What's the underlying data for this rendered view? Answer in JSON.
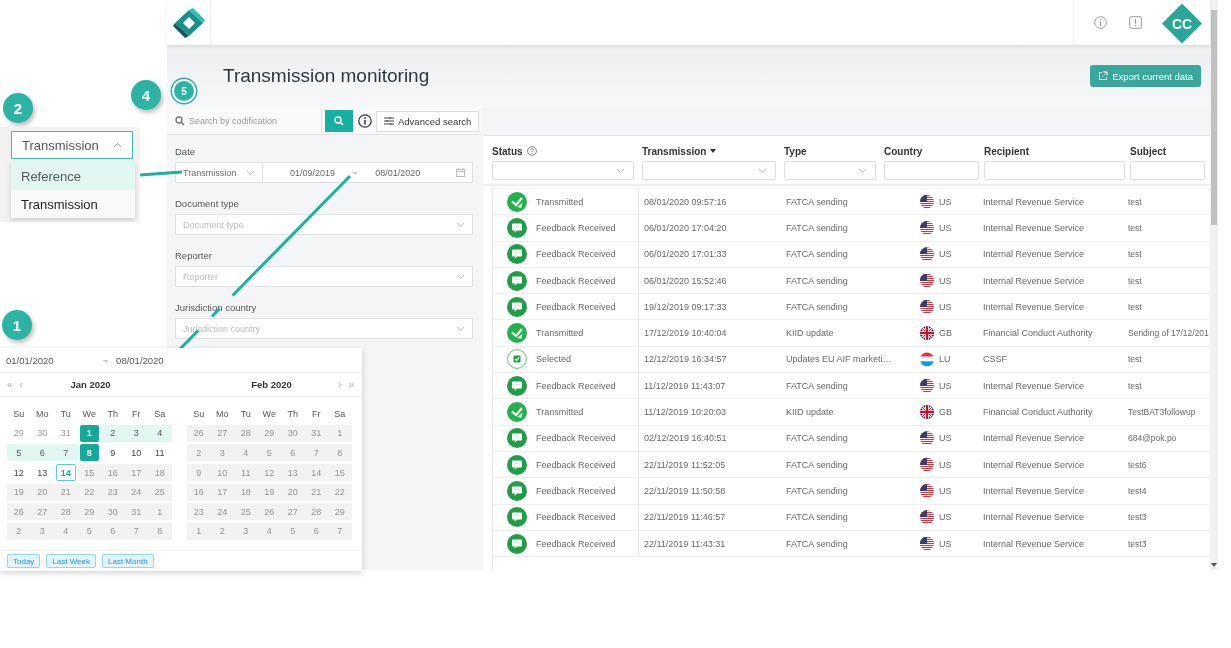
{
  "app": {
    "header": {
      "avatar": "CC"
    },
    "title": "Transmission monitoring",
    "export_button": "Export current data",
    "search": {
      "placeholder": "Search by codification",
      "advanced_button": "Advanced search"
    },
    "filters": [
      {
        "label": "Date",
        "kind": "date",
        "type_value": "Transmission",
        "from": "01/09/2019",
        "separator": "~",
        "to": "08/01/2020"
      },
      {
        "label": "Document type",
        "kind": "select",
        "placeholder": "Document type"
      },
      {
        "label": "Reporter",
        "kind": "select",
        "placeholder": "Reporter"
      },
      {
        "label": "Jurisdiction country",
        "kind": "select",
        "placeholder": "Jurisdiction country"
      }
    ],
    "table": {
      "columns": [
        {
          "label": "Status",
          "help": true,
          "sorted": false,
          "kind": "select"
        },
        {
          "label": "Transmission",
          "help": false,
          "sorted": true,
          "kind": "select"
        },
        {
          "label": "Type",
          "help": false,
          "sorted": false,
          "kind": "select"
        },
        {
          "label": "Country",
          "help": false,
          "sorted": false,
          "kind": "text"
        },
        {
          "label": "Recipient",
          "help": false,
          "sorted": false,
          "kind": "text"
        },
        {
          "label": "Subject",
          "help": false,
          "sorted": false,
          "kind": "text"
        }
      ],
      "rows": [
        {
          "status": {
            "label": "Transmitted",
            "kind": "transmitted"
          },
          "date": "08/01/2020 09:57:16",
          "type": "FATCA sending",
          "country": {
            "code": "US",
            "kind": "us"
          },
          "recipient": "Internal Revenue Service",
          "subject": "test"
        },
        {
          "status": {
            "label": "Feedback Received",
            "kind": "feedback"
          },
          "date": "06/01/2020 17:04:20",
          "type": "FATCA sending",
          "country": {
            "code": "US",
            "kind": "us"
          },
          "recipient": "Internal Revenue Service",
          "subject": "test"
        },
        {
          "status": {
            "label": "Feedback Received",
            "kind": "feedback"
          },
          "date": "06/01/2020 17:01:33",
          "type": "FATCA sending",
          "country": {
            "code": "US",
            "kind": "us"
          },
          "recipient": "Internal Revenue Service",
          "subject": "test"
        },
        {
          "status": {
            "label": "Feedback Received",
            "kind": "feedback"
          },
          "date": "06/01/2020 15:52:46",
          "type": "FATCA sending",
          "country": {
            "code": "US",
            "kind": "us"
          },
          "recipient": "Internal Revenue Service",
          "subject": "test"
        },
        {
          "status": {
            "label": "Feedback Received",
            "kind": "feedback"
          },
          "date": "19/12/2019 09:17:33",
          "type": "FATCA sending",
          "country": {
            "code": "US",
            "kind": "us"
          },
          "recipient": "Internal Revenue Service",
          "subject": "test"
        },
        {
          "status": {
            "label": "Transmitted",
            "kind": "transmitted"
          },
          "date": "17/12/2019 10:40:04",
          "type": "KIID update",
          "country": {
            "code": "GB",
            "kind": "gb"
          },
          "recipient": "Financial Conduct Authority",
          "subject": "Sending of 17/12/201"
        },
        {
          "status": {
            "label": "Selected",
            "kind": "selected"
          },
          "date": "12/12/2019 16:34:57",
          "type": "Updates EU AIF marketi…",
          "country": {
            "code": "LU",
            "kind": "lu"
          },
          "recipient": "CSSF",
          "subject": "test"
        },
        {
          "status": {
            "label": "Feedback Received",
            "kind": "feedback"
          },
          "date": "11/12/2019 11:43:07",
          "type": "FATCA sending",
          "country": {
            "code": "US",
            "kind": "us"
          },
          "recipient": "Internal Revenue Service",
          "subject": "test"
        },
        {
          "status": {
            "label": "Transmitted",
            "kind": "transmitted"
          },
          "date": "11/12/2019 10:20:03",
          "type": "KIID update",
          "country": {
            "code": "GB",
            "kind": "gb"
          },
          "recipient": "Financial Conduct Authority",
          "subject": "TestBAT3followup"
        },
        {
          "status": {
            "label": "Feedback Received",
            "kind": "feedback"
          },
          "date": "02/12/2019 16:40:51",
          "type": "FATCA sending",
          "country": {
            "code": "US",
            "kind": "us"
          },
          "recipient": "Internal Revenue Service",
          "subject": "684@pok.po"
        },
        {
          "status": {
            "label": "Feedback Received",
            "kind": "feedback"
          },
          "date": "22/11/2019 11:52:05",
          "type": "FATCA sending",
          "country": {
            "code": "US",
            "kind": "us"
          },
          "recipient": "Internal Revenue Service",
          "subject": "test6"
        },
        {
          "status": {
            "label": "Feedback Received",
            "kind": "feedback"
          },
          "date": "22/11/2019 11:50:58",
          "type": "FATCA sending",
          "country": {
            "code": "US",
            "kind": "us"
          },
          "recipient": "Internal Revenue Service",
          "subject": "test4"
        },
        {
          "status": {
            "label": "Feedback Received",
            "kind": "feedback"
          },
          "date": "22/11/2019 11:46:57",
          "type": "FATCA sending",
          "country": {
            "code": "US",
            "kind": "us"
          },
          "recipient": "Internal Revenue Service",
          "subject": "test3"
        },
        {
          "status": {
            "label": "Feedback Received",
            "kind": "feedback"
          },
          "date": "22/11/2019 11:43:31",
          "type": "FATCA sending",
          "country": {
            "code": "US",
            "kind": "us"
          },
          "recipient": "Internal Revenue Service",
          "subject": "test3"
        }
      ]
    }
  },
  "callouts": [
    {
      "label": "2",
      "kind": "filled"
    },
    {
      "label": "4",
      "kind": "filled"
    },
    {
      "label": "5",
      "kind": "outlined"
    },
    {
      "label": "1",
      "kind": "filled"
    }
  ],
  "type_dropdown": {
    "value": "Transmission",
    "expanded": true,
    "options": [
      {
        "label": "Reference",
        "hovered": true,
        "selected": false
      },
      {
        "label": "Transmission",
        "hovered": false,
        "selected": true
      }
    ]
  },
  "calendar_popup": {
    "from": "01/01/2020",
    "separator": "~",
    "to": "08/01/2020",
    "nav_prev": [
      "«",
      "‹"
    ],
    "nav_next": [
      "›",
      "»"
    ],
    "months": [
      {
        "title": "Jan 2020",
        "weekdays": [
          "Su",
          "Mo",
          "Tu",
          "We",
          "Th",
          "Fr",
          "Sa"
        ],
        "weeks": [
          [
            {
              "day": "29",
              "kind": "outside"
            },
            {
              "day": "30",
              "kind": "outside"
            },
            {
              "day": "31",
              "kind": "outside"
            },
            {
              "day": "1",
              "kind": "selected"
            },
            {
              "day": "2",
              "kind": "in_range"
            },
            {
              "day": "3",
              "kind": "in_range"
            },
            {
              "day": "4",
              "kind": "in_range"
            }
          ],
          [
            {
              "day": "5",
              "kind": "in_range"
            },
            {
              "day": "6",
              "kind": "in_range"
            },
            {
              "day": "7",
              "kind": "in_range"
            },
            {
              "day": "8",
              "kind": "selected"
            },
            {
              "day": "9",
              "kind": "normal"
            },
            {
              "day": "10",
              "kind": "normal"
            },
            {
              "day": "11",
              "kind": "normal"
            }
          ],
          [
            {
              "day": "12",
              "kind": "normal"
            },
            {
              "day": "13",
              "kind": "normal"
            },
            {
              "day": "14",
              "kind": "today"
            },
            {
              "day": "15",
              "kind": "disabled"
            },
            {
              "day": "16",
              "kind": "disabled"
            },
            {
              "day": "17",
              "kind": "disabled"
            },
            {
              "day": "18",
              "kind": "disabled"
            }
          ],
          [
            {
              "day": "19",
              "kind": "disabled"
            },
            {
              "day": "20",
              "kind": "disabled"
            },
            {
              "day": "21",
              "kind": "disabled"
            },
            {
              "day": "22",
              "kind": "disabled"
            },
            {
              "day": "23",
              "kind": "disabled"
            },
            {
              "day": "24",
              "kind": "disabled"
            },
            {
              "day": "25",
              "kind": "disabled"
            }
          ],
          [
            {
              "day": "26",
              "kind": "disabled"
            },
            {
              "day": "27",
              "kind": "disabled"
            },
            {
              "day": "28",
              "kind": "disabled"
            },
            {
              "day": "29",
              "kind": "disabled"
            },
            {
              "day": "30",
              "kind": "disabled"
            },
            {
              "day": "31",
              "kind": "disabled"
            },
            {
              "day": "1",
              "kind": "disabled"
            }
          ],
          [
            {
              "day": "2",
              "kind": "disabled"
            },
            {
              "day": "3",
              "kind": "disabled"
            },
            {
              "day": "4",
              "kind": "disabled"
            },
            {
              "day": "5",
              "kind": "disabled"
            },
            {
              "day": "6",
              "kind": "disabled"
            },
            {
              "day": "7",
              "kind": "disabled"
            },
            {
              "day": "8",
              "kind": "disabled"
            }
          ]
        ]
      },
      {
        "title": "Feb 2020",
        "weekdays": [
          "Su",
          "Mo",
          "Tu",
          "We",
          "Th",
          "Fr",
          "Sa"
        ],
        "weeks": [
          [
            {
              "day": "26",
              "kind": "disabled"
            },
            {
              "day": "27",
              "kind": "disabled"
            },
            {
              "day": "28",
              "kind": "disabled"
            },
            {
              "day": "29",
              "kind": "disabled"
            },
            {
              "day": "30",
              "kind": "disabled"
            },
            {
              "day": "31",
              "kind": "disabled"
            },
            {
              "day": "1",
              "kind": "disabled"
            }
          ],
          [
            {
              "day": "2",
              "kind": "disabled"
            },
            {
              "day": "3",
              "kind": "disabled"
            },
            {
              "day": "4",
              "kind": "disabled"
            },
            {
              "day": "5",
              "kind": "disabled"
            },
            {
              "day": "6",
              "kind": "disabled"
            },
            {
              "day": "7",
              "kind": "disabled"
            },
            {
              "day": "8",
              "kind": "disabled"
            }
          ],
          [
            {
              "day": "9",
              "kind": "disabled"
            },
            {
              "day": "10",
              "kind": "disabled"
            },
            {
              "day": "11",
              "kind": "disabled"
            },
            {
              "day": "12",
              "kind": "disabled"
            },
            {
              "day": "13",
              "kind": "disabled"
            },
            {
              "day": "14",
              "kind": "disabled"
            },
            {
              "day": "15",
              "kind": "disabled"
            }
          ],
          [
            {
              "day": "16",
              "kind": "disabled"
            },
            {
              "day": "17",
              "kind": "disabled"
            },
            {
              "day": "18",
              "kind": "disabled"
            },
            {
              "day": "19",
              "kind": "disabled"
            },
            {
              "day": "20",
              "kind": "disabled"
            },
            {
              "day": "21",
              "kind": "disabled"
            },
            {
              "day": "22",
              "kind": "disabled"
            }
          ],
          [
            {
              "day": "23",
              "kind": "disabled"
            },
            {
              "day": "24",
              "kind": "disabled"
            },
            {
              "day": "25",
              "kind": "disabled"
            },
            {
              "day": "26",
              "kind": "disabled"
            },
            {
              "day": "27",
              "kind": "disabled"
            },
            {
              "day": "28",
              "kind": "disabled"
            },
            {
              "day": "29",
              "kind": "disabled"
            }
          ],
          [
            {
              "day": "1",
              "kind": "disabled"
            },
            {
              "day": "2",
              "kind": "disabled"
            },
            {
              "day": "3",
              "kind": "disabled"
            },
            {
              "day": "4",
              "kind": "disabled"
            },
            {
              "day": "5",
              "kind": "disabled"
            },
            {
              "day": "6",
              "kind": "disabled"
            },
            {
              "day": "7",
              "kind": "disabled"
            }
          ]
        ]
      }
    ],
    "presets": [
      "Today",
      "Last Week",
      "Last Month"
    ]
  }
}
